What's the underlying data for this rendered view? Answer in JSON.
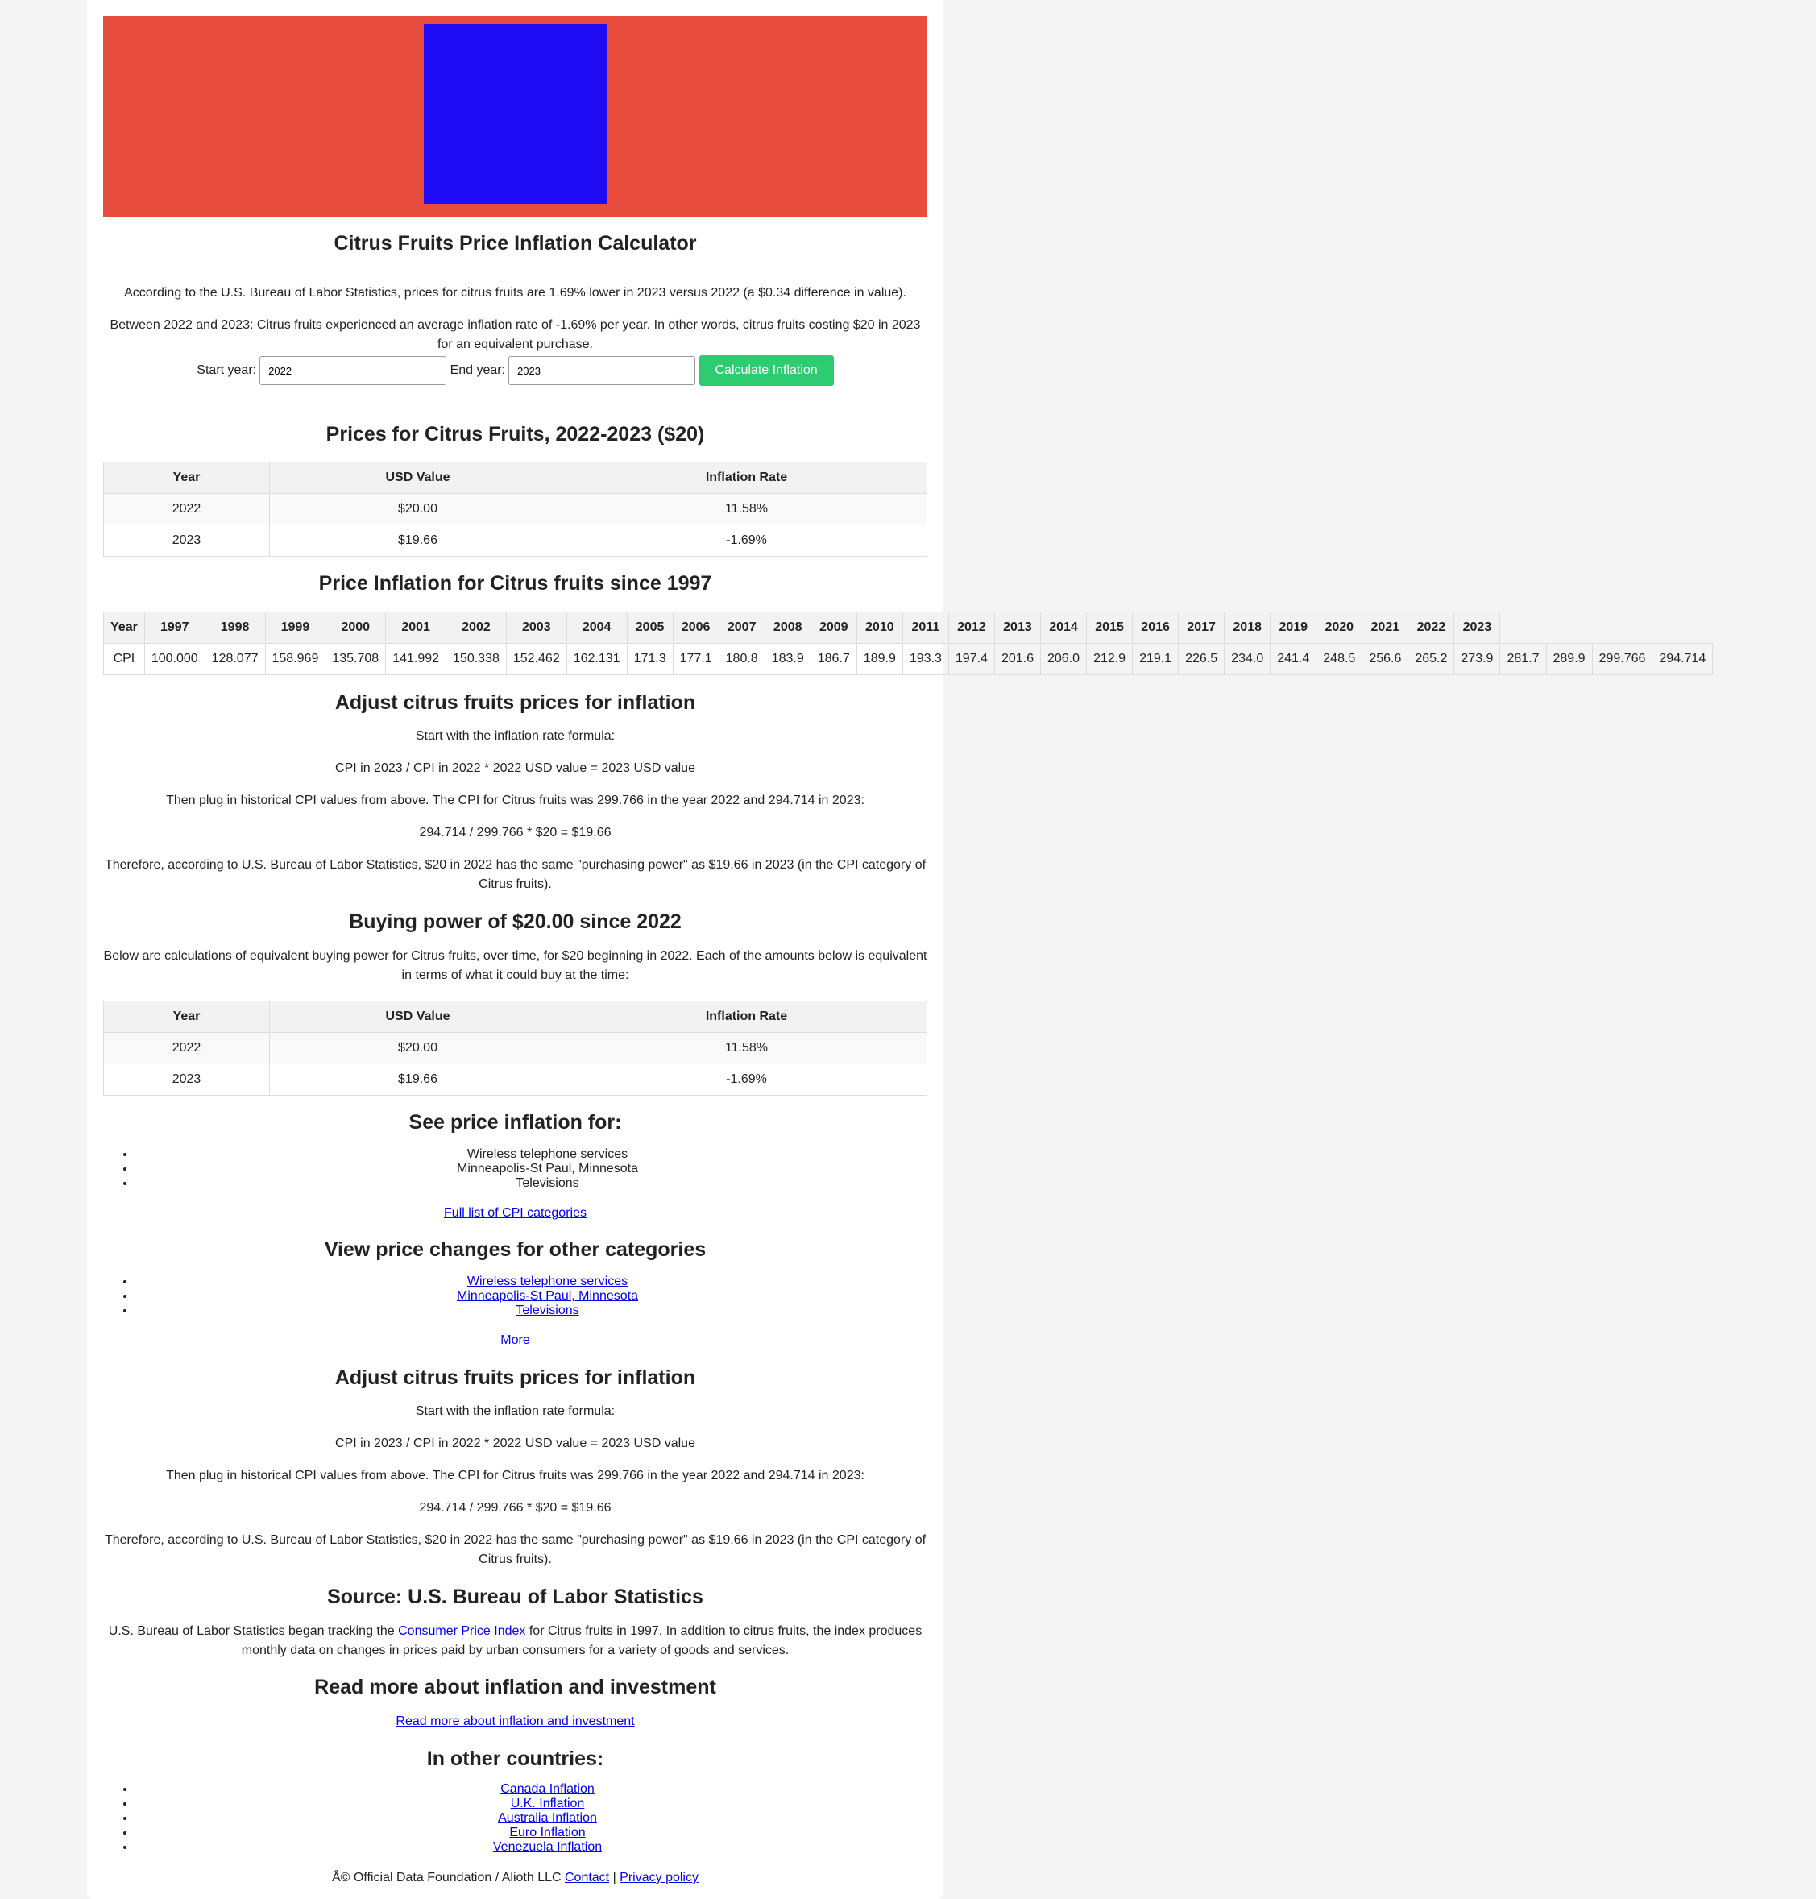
{
  "page": {
    "title": "Citrus Fruits Price Inflation Calculator",
    "intro1": "According to the U.S. Bureau of Labor Statistics, prices for citrus fruits are 1.69% lower in 2023 versus 2022 (a $0.34 difference in value).",
    "intro2": "Between 2022 and 2023: Citrus fruits experienced an average inflation rate of -1.69% per year. In other words, citrus fruits costing $20 in 2023 for an equivalent purchase."
  },
  "form": {
    "start_label": "Start year:",
    "start_value": "2022",
    "end_label": "End year:",
    "end_value": "2023",
    "button": "Calculate Inflation"
  },
  "prices": {
    "heading": "Prices for Citrus Fruits, 2022-2023 ($20)",
    "headers": [
      "Year",
      "USD Value",
      "Inflation Rate"
    ],
    "rows": [
      [
        "2022",
        "$20.00",
        "11.58%"
      ],
      [
        "2023",
        "$19.66",
        "-1.69%"
      ]
    ]
  },
  "cpi": {
    "heading": "Price Inflation for Citrus fruits since 1997",
    "year_label": "Year",
    "cpi_label": "CPI",
    "years": [
      "1997",
      "1998",
      "1999",
      "2000",
      "2001",
      "2002",
      "2003",
      "2004",
      "2005",
      "2006",
      "2007",
      "2008",
      "2009",
      "2010",
      "2011",
      "2012",
      "2013",
      "2014",
      "2015",
      "2016",
      "2017",
      "2018",
      "2019",
      "2020",
      "2021",
      "2022",
      "2023"
    ],
    "values": [
      "100.000",
      "128.077",
      "158.969",
      "135.708",
      "141.992",
      "150.338",
      "152.462",
      "162.131",
      "171.3",
      "177.1",
      "180.8",
      "183.9",
      "186.7",
      "189.9",
      "193.3",
      "197.4",
      "201.6",
      "206.0",
      "212.9",
      "219.1",
      "226.5",
      "234.0",
      "241.4",
      "248.5",
      "256.6",
      "265.2",
      "273.9",
      "281.7",
      "289.9",
      "299.766",
      "294.714"
    ]
  },
  "adjust1": {
    "heading": "Adjust citrus fruits prices for inflation",
    "p1": "Start with the inflation rate formula:",
    "p2": "CPI in 2023 / CPI in 2022 * 2022 USD value = 2023 USD value",
    "p3": "Then plug in historical CPI values from above. The CPI for Citrus fruits was 299.766 in the year 2022 and 294.714 in 2023:",
    "p4": "294.714 / 299.766 * $20 = $19.66",
    "p5": "Therefore, according to U.S. Bureau of Labor Statistics, $20 in 2022 has the same \"purchasing power\" as $19.66 in 2023 (in the CPI category of Citrus fruits)."
  },
  "buying": {
    "heading": "Buying power of $20.00 since 2022",
    "desc": "Below are calculations of equivalent buying power for Citrus fruits, over time, for $20 beginning in 2022. Each of the amounts below is equivalent in terms of what it could buy at the time:",
    "headers": [
      "Year",
      "USD Value",
      "Inflation Rate"
    ],
    "rows": [
      [
        "2022",
        "$20.00",
        "11.58%"
      ],
      [
        "2023",
        "$19.66",
        "-1.69%"
      ]
    ]
  },
  "see": {
    "heading": "See price inflation for:",
    "items": [
      "Wireless telephone services",
      "Minneapolis-St Paul, Minnesota",
      "Televisions"
    ],
    "link": "Full list of CPI categories"
  },
  "view": {
    "heading": "View price changes for other categories",
    "items": [
      "Wireless telephone services",
      "Minneapolis-St Paul, Minnesota",
      "Televisions"
    ],
    "more": "More"
  },
  "adjust2": {
    "heading": "Adjust citrus fruits prices for inflation",
    "p1": "Start with the inflation rate formula:",
    "p2": "CPI in 2023 / CPI in 2022 * 2022 USD value = 2023 USD value",
    "p3": "Then plug in historical CPI values from above. The CPI for Citrus fruits was 299.766 in the year 2022 and 294.714 in 2023:",
    "p4": "294.714 / 299.766 * $20 = $19.66",
    "p5": "Therefore, according to U.S. Bureau of Labor Statistics, $20 in 2022 has the same \"purchasing power\" as $19.66 in 2023 (in the CPI category of Citrus fruits)."
  },
  "source": {
    "heading": "Source: U.S. Bureau of Labor Statistics",
    "text_before": "U.S. Bureau of Labor Statistics began tracking the ",
    "link": "Consumer Price Index",
    "text_after": " for Citrus fruits in 1997. In addition to citrus fruits, the index produces monthly data on changes in prices paid by urban consumers for a variety of goods and services."
  },
  "readmore": {
    "heading": "Read more about inflation and investment",
    "link": "Read more about inflation and investment"
  },
  "countries": {
    "heading": "In other countries:",
    "items": [
      "Canada Inflation",
      "U.K. Inflation",
      "Australia Inflation",
      "Euro Inflation",
      "Venezuela Inflation"
    ]
  },
  "footer": {
    "copyright": "Â© Official Data Foundation / Alioth LLC ",
    "contact": "Contact",
    "sep": " | ",
    "privacy": "Privacy policy"
  }
}
